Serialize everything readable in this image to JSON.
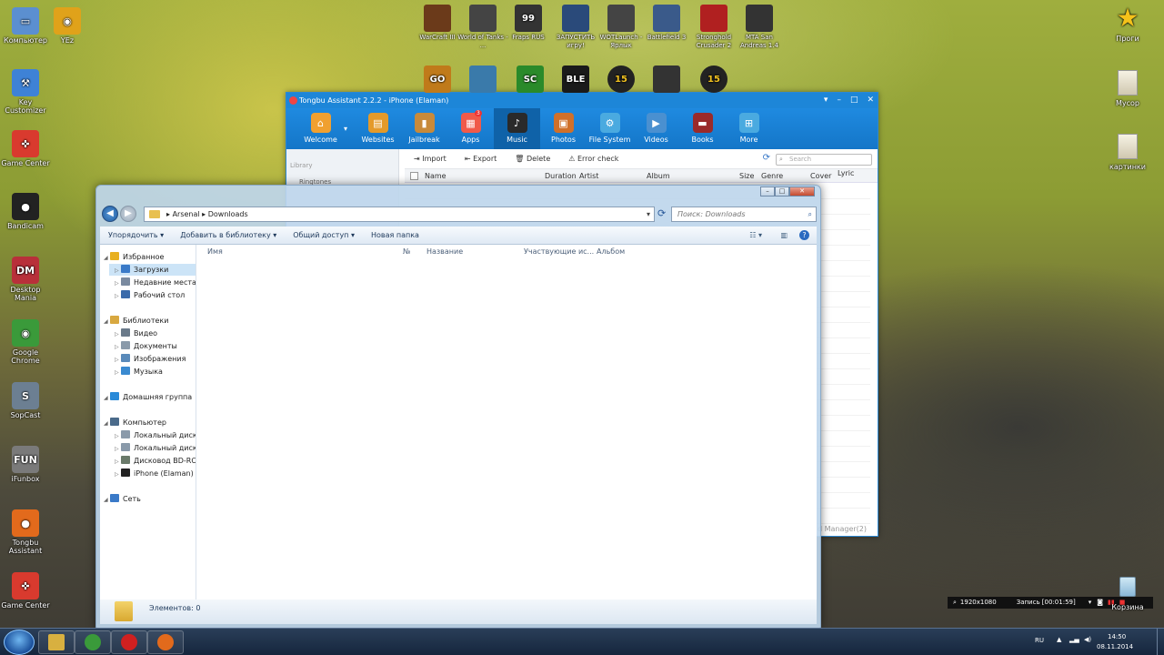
{
  "desktop": {
    "left_icons": [
      {
        "label": "Компьютер",
        "icon": "computer-icon",
        "color": "#5b8fd0",
        "glyph": "▭"
      },
      {
        "label": "YEz",
        "icon": "chrome-icon",
        "color": "#e0a21a",
        "glyph": "◉"
      },
      {
        "label": "Key Customizer",
        "icon": "key-customizer-icon",
        "color": "#3e82d6",
        "glyph": "⚒"
      },
      {
        "label": "Game Center",
        "icon": "gamepad-icon",
        "color": "#d93a2e",
        "glyph": "✜"
      },
      {
        "label": "Bandicam",
        "icon": "bandicam-icon",
        "color": "#222222",
        "glyph": "●"
      },
      {
        "label": "Desktop Mania",
        "icon": "desktop-mania-icon",
        "color": "#b8303a",
        "glyph": "DM"
      },
      {
        "label": "Google Chrome",
        "icon": "chrome-icon",
        "color": "#3a9a3a",
        "glyph": "◉"
      },
      {
        "label": "SopCast",
        "icon": "sopcast-icon",
        "color": "#6c7f92",
        "glyph": "S"
      },
      {
        "label": "iFunbox",
        "icon": "ifunbox-icon",
        "color": "#7a7a7a",
        "glyph": "FUN"
      },
      {
        "label": "Tongbu Assistant",
        "icon": "tongbu-icon",
        "color": "#e26a1c",
        "glyph": "●"
      },
      {
        "label": "Game Center",
        "icon": "gamepad-icon",
        "color": "#d93a2e",
        "glyph": "✜"
      }
    ],
    "top_icons": [
      {
        "label": "WarCraft III",
        "icon": "warcraft-icon",
        "color": "#6b3a1a"
      },
      {
        "label": "World of Tanks - ...",
        "icon": "wot-icon",
        "color": "#444444"
      },
      {
        "label": "Fraps RUS",
        "icon": "fraps-icon",
        "color": "#333333",
        "glyph": "99"
      },
      {
        "label": "ЗАПУСТИТЬ игру!",
        "icon": "fifa-icon",
        "color": "#2a4a7a"
      },
      {
        "label": "WOTLaunch - Ярлык",
        "icon": "wot-icon",
        "color": "#444444"
      },
      {
        "label": "Battlefield 3",
        "icon": "battlefield-icon",
        "color": "#3a5a8a"
      },
      {
        "label": "Stronghold Crusader 2",
        "icon": "stronghold-icon",
        "color": "#b02020"
      },
      {
        "label": "MTA San Andreas 1.4",
        "icon": "mta-icon",
        "color": "#333333"
      }
    ],
    "second_row_icons": [
      {
        "icon": "csgo-icon",
        "color": "#c07a1a",
        "glyph": "GO"
      },
      {
        "icon": "game-icon",
        "color": "#3a7aaa"
      },
      {
        "icon": "sc-icon",
        "color": "#2a8a2a",
        "glyph": "SC"
      },
      {
        "icon": "game-icon",
        "color": "#1a1a1a",
        "glyph": "BLE"
      },
      {
        "icon": "pes-icon",
        "color": "#222222",
        "glyph": "15"
      },
      {
        "icon": "game-icon",
        "color": "#333333"
      },
      {
        "icon": "pes-icon",
        "color": "#222222",
        "glyph": "15"
      }
    ],
    "right_icons": [
      {
        "label": "Проги",
        "icon": "star-icon"
      },
      {
        "label": "Мусор",
        "icon": "folder-icon"
      },
      {
        "label": "картинки",
        "icon": "folder-icon"
      },
      {
        "label": "Корзина",
        "icon": "recycle-bin-icon"
      }
    ]
  },
  "tongbu": {
    "title": "Tongbu Assistant 2.2.2 - iPhone (Elaman)",
    "nav": [
      {
        "label": "Welcome",
        "icon": "home-icon",
        "color": "#f0a030",
        "glyph": "⌂"
      },
      {
        "label": "Websites",
        "icon": "websites-icon",
        "color": "#e49a2a",
        "glyph": "▤"
      },
      {
        "label": "Jailbreak",
        "icon": "jailbreak-icon",
        "color": "#c88a3a",
        "glyph": "▮"
      },
      {
        "label": "Apps",
        "icon": "apps-icon",
        "color": "#f05a4a",
        "glyph": "▦",
        "badge": "3"
      },
      {
        "label": "Music",
        "icon": "music-icon",
        "color": "#2a2a2a",
        "glyph": "♪"
      },
      {
        "label": "Photos",
        "icon": "photos-icon",
        "color": "#d0702a",
        "glyph": "▣"
      },
      {
        "label": "File System",
        "icon": "file-system-icon",
        "color": "#4aaae0",
        "glyph": "⚙"
      },
      {
        "label": "Videos",
        "icon": "videos-icon",
        "color": "#4a90d0",
        "glyph": "▶"
      },
      {
        "label": "Books",
        "icon": "books-icon",
        "color": "#9a2a2a",
        "glyph": "▬"
      },
      {
        "label": "More",
        "icon": "more-icon",
        "color": "#4aaae0",
        "glyph": "⊞"
      }
    ],
    "sidebar_header": "Library",
    "sidebar_items": [
      "Ringtones"
    ],
    "toolbar": {
      "import": "Import",
      "export": "Export",
      "delete": "Delete",
      "error_check": "Error check"
    },
    "search_placeholder": "Search",
    "columns": [
      "Name",
      "Duration",
      "Artist",
      "Album",
      "Size",
      "Genre",
      "Cover",
      "Lyric"
    ],
    "footer": "d Manager(2)"
  },
  "explorer": {
    "path": [
      "Arsenal",
      "Downloads"
    ],
    "search_placeholder": "Поиск: Downloads",
    "commands": [
      "Упорядочить",
      "Добавить в библиотеку",
      "Общий доступ",
      "Новая папка"
    ],
    "tree": [
      {
        "label": "Избранное",
        "level": 0,
        "icon": "star-icon",
        "color": "#e8b020"
      },
      {
        "label": "Загрузки",
        "level": 1,
        "icon": "downloads-folder-icon",
        "color": "#3a7ac8",
        "selected": true
      },
      {
        "label": "Недавние места",
        "level": 1,
        "icon": "recent-places-icon",
        "color": "#7a8aa0"
      },
      {
        "label": "Рабочий стол",
        "level": 1,
        "icon": "desktop-icon",
        "color": "#3a6aaa"
      },
      {
        "label": "Библиотеки",
        "level": 0,
        "icon": "libraries-icon",
        "color": "#d8a840"
      },
      {
        "label": "Видео",
        "level": 1,
        "icon": "video-library-icon",
        "color": "#6a7a8a"
      },
      {
        "label": "Документы",
        "level": 1,
        "icon": "documents-icon",
        "color": "#8a9aaa"
      },
      {
        "label": "Изображения",
        "level": 1,
        "icon": "pictures-icon",
        "color": "#5a8aba"
      },
      {
        "label": "Музыка",
        "level": 1,
        "icon": "music-library-icon",
        "color": "#3a8ad0"
      },
      {
        "label": "Домашняя группа",
        "level": 0,
        "icon": "homegroup-icon",
        "color": "#2a8ad8"
      },
      {
        "label": "Компьютер",
        "level": 0,
        "icon": "computer-icon",
        "color": "#4a6a8a"
      },
      {
        "label": "Локальный диск (C",
        "level": 1,
        "icon": "drive-icon",
        "color": "#8a9aaa"
      },
      {
        "label": "Локальный диск (D",
        "level": 1,
        "icon": "drive-icon",
        "color": "#8a9aaa"
      },
      {
        "label": "Дисковод BD-ROM",
        "level": 1,
        "icon": "bd-rom-icon",
        "color": "#6a7a6a"
      },
      {
        "label": "iPhone (Elaman)",
        "level": 1,
        "icon": "iphone-icon",
        "color": "#222222"
      },
      {
        "label": "Сеть",
        "level": 0,
        "icon": "network-icon",
        "color": "#3a7ac8"
      }
    ],
    "columns": [
      "Имя",
      "№",
      "Название",
      "Участвующие ис...",
      "Альбом"
    ],
    "status": "Элементов: 0"
  },
  "bandicam": {
    "resolution": "1920x1080",
    "recording": "Запись [00:01:59]"
  },
  "taskbar": {
    "apps": [
      {
        "icon": "explorer-icon",
        "color": "#d8b040"
      },
      {
        "icon": "chrome-icon",
        "color": "#3a9a3a"
      },
      {
        "icon": "bandicam-icon",
        "color": "#d02020"
      },
      {
        "icon": "tongbu-icon",
        "color": "#e26a1c"
      }
    ],
    "language": "RU",
    "time": "14:50",
    "date": "08.11.2014"
  }
}
